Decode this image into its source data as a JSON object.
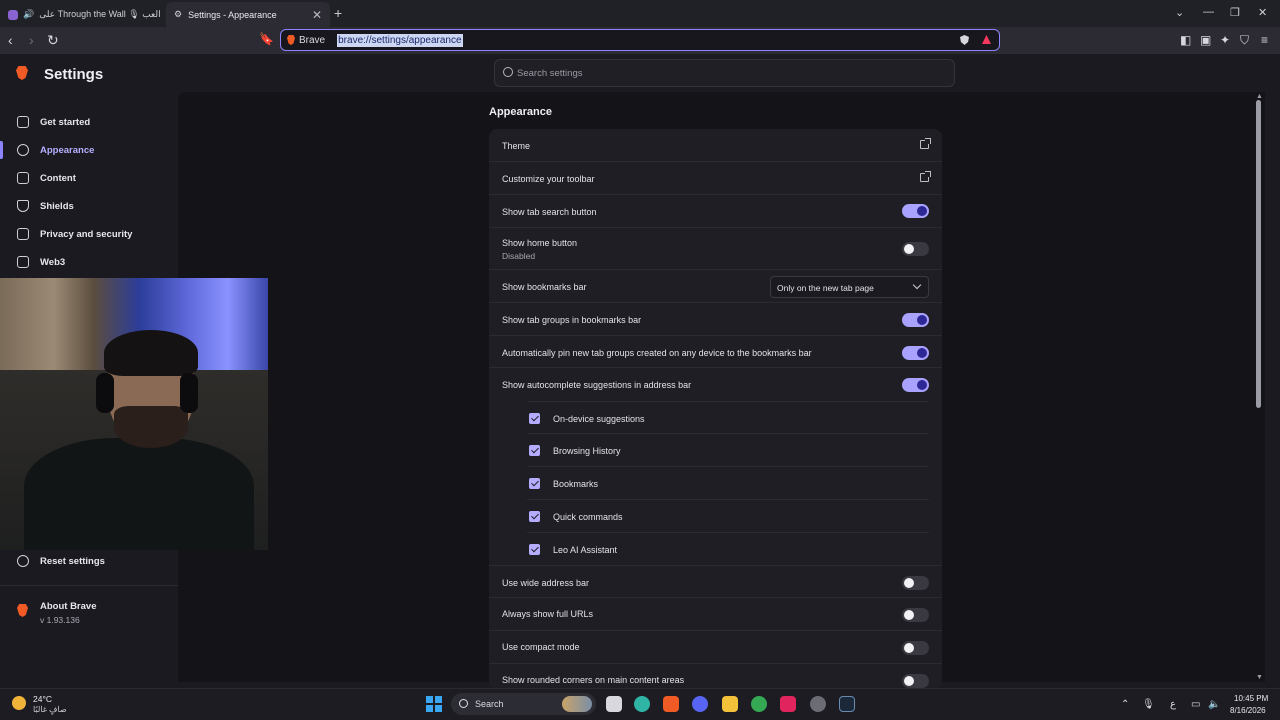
{
  "tabs": [
    {
      "title": "على Through the Wall 🎙 العب",
      "state": "inactive"
    },
    {
      "title": "Settings - Appearance",
      "state": "active"
    }
  ],
  "toolbar": {
    "brave_label": "Brave",
    "url": "brave://settings/appearance"
  },
  "settings_title": "Settings",
  "search_placeholder": "Search settings",
  "sidebar": {
    "items": [
      {
        "label": "Get started",
        "icon": "rocket-icon"
      },
      {
        "label": "Appearance",
        "icon": "palette-icon",
        "active": true
      },
      {
        "label": "Content",
        "icon": "content-icon"
      },
      {
        "label": "Shields",
        "icon": "shield-icon"
      },
      {
        "label": "Privacy and security",
        "icon": "lock-icon"
      },
      {
        "label": "Web3",
        "icon": "wallet-icon"
      }
    ],
    "reset": "Reset settings",
    "about_title": "About Brave",
    "about_version": "v 1.93.136"
  },
  "section_title": "Appearance",
  "rows": [
    {
      "label": "Theme",
      "control": "external-link"
    },
    {
      "label": "Customize your toolbar",
      "control": "external-link"
    },
    {
      "label": "Show tab search button",
      "control": "toggle",
      "on": true
    },
    {
      "label": "Show home button",
      "sub": "Disabled",
      "control": "toggle",
      "on": false
    },
    {
      "label": "Show bookmarks bar",
      "control": "dropdown",
      "value": "Only on the new tab page"
    },
    {
      "label": "Show tab groups in bookmarks bar",
      "control": "toggle",
      "on": true
    },
    {
      "label": "Automatically pin new tab groups created on any device to the bookmarks bar",
      "control": "toggle",
      "on": true
    },
    {
      "label": "Show autocomplete suggestions in address bar",
      "control": "toggle",
      "on": true
    }
  ],
  "autocomplete_options": [
    {
      "label": "On-device suggestions",
      "checked": true
    },
    {
      "label": "Browsing History",
      "checked": true
    },
    {
      "label": "Bookmarks",
      "checked": true
    },
    {
      "label": "Quick commands",
      "checked": true
    },
    {
      "label": "Leo AI Assistant",
      "checked": true
    }
  ],
  "rows_after": [
    {
      "label": "Use wide address bar",
      "control": "toggle",
      "on": false
    },
    {
      "label": "Always show full URLs",
      "control": "toggle",
      "on": false
    },
    {
      "label": "Use compact mode",
      "control": "toggle",
      "on": false
    },
    {
      "label": "Show rounded corners on main content areas",
      "control": "toggle",
      "on": false
    }
  ],
  "taskbar": {
    "temperature": "24°C",
    "condition": "صافٍ غالبًا",
    "search_label": "Search",
    "time": "10:45 PM",
    "date": "8/16/2026",
    "ime": "ع"
  },
  "colors": {
    "accent": "#a9a2ff",
    "brave_orange": "#f05a24",
    "background": "#141318"
  }
}
